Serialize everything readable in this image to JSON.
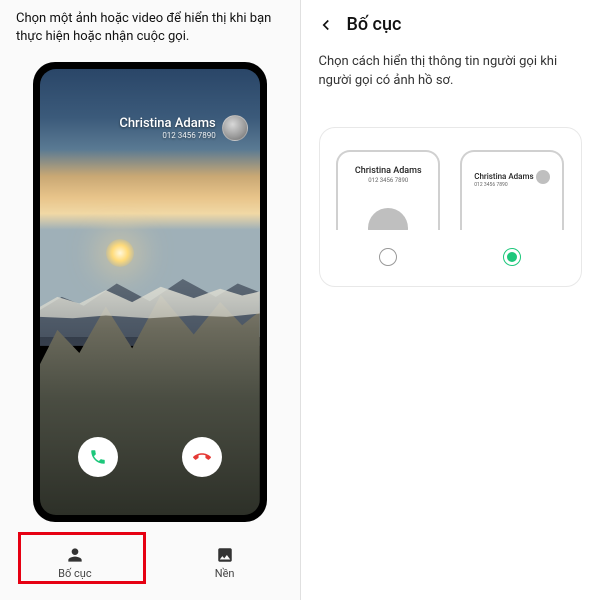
{
  "left": {
    "header": "Chọn một ảnh hoặc video để hiển thị khi bạn thực hiện hoặc nhận cuộc gọi.",
    "caller": {
      "name": "Christina Adams",
      "number": "012 3456 7890"
    },
    "tabs": {
      "layout": "Bố cục",
      "background": "Nền"
    }
  },
  "right": {
    "title": "Bố cục",
    "desc": "Chọn cách hiển thị thông tin người gọi khi người gọi có ảnh hồ sơ.",
    "sample": {
      "name": "Christina Adams",
      "number": "012 3456 7890"
    }
  },
  "colors": {
    "accent": "#1dc77b",
    "highlight": "#e60012"
  }
}
